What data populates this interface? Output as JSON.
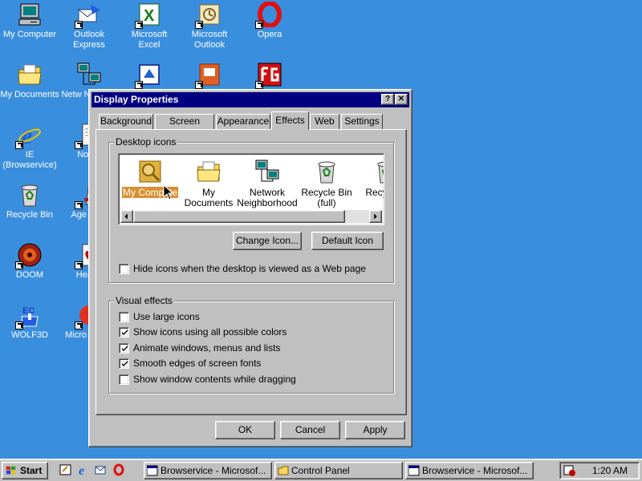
{
  "desktop": {
    "icons": [
      {
        "label": "My Computer"
      },
      {
        "label": "Outlook Express"
      },
      {
        "label": "Microsoft Excel"
      },
      {
        "label": "Microsoft Outlook"
      },
      {
        "label": "Opera"
      },
      {
        "label": "My Documents"
      },
      {
        "label": "Netw Neighbo"
      },
      {
        "label": "IE (Browservice)"
      },
      {
        "label": "Notep"
      },
      {
        "label": "Recycle Bin"
      },
      {
        "label": "Age Emp"
      },
      {
        "label": "DOOM"
      },
      {
        "label": "Hearts"
      },
      {
        "label": "WOLF3D"
      },
      {
        "label": "Micro Visual"
      }
    ]
  },
  "dialog": {
    "title": "Display Properties",
    "help_button": "?",
    "close_button": "✕",
    "tabs": [
      {
        "label": "Background"
      },
      {
        "label": "Screen Saver"
      },
      {
        "label": "Appearance"
      },
      {
        "label": "Effects"
      },
      {
        "label": "Web"
      },
      {
        "label": "Settings"
      }
    ],
    "active_tab": "Effects",
    "desktop_icons": {
      "group_label": "Desktop icons",
      "items": [
        {
          "label": "My Compute",
          "selected": true
        },
        {
          "label": "My Documents"
        },
        {
          "label": "Network Neighborhood"
        },
        {
          "label": "Recycle Bin (full)"
        },
        {
          "label": "Recy (em"
        }
      ],
      "change_icon_button": "Change Icon...",
      "default_icon_button": "Default Icon",
      "hide_icons_checkbox": {
        "label": "Hide icons when the desktop is viewed as a Web page",
        "checked": false
      }
    },
    "visual_effects": {
      "group_label": "Visual effects",
      "options": [
        {
          "label": "Use large icons",
          "checked": false
        },
        {
          "label": "Show icons using all possible colors",
          "checked": true
        },
        {
          "label": "Animate windows, menus and lists",
          "checked": true
        },
        {
          "label": "Smooth edges of screen fonts",
          "checked": true
        },
        {
          "label": "Show window contents while dragging",
          "checked": false
        }
      ]
    },
    "buttons": {
      "ok": "OK",
      "cancel": "Cancel",
      "apply": "Apply"
    }
  },
  "taskbar": {
    "start_label": "Start",
    "tasks": [
      {
        "label": "Browservice - Microsof..."
      },
      {
        "label": "Control Panel"
      },
      {
        "label": "Browservice - Microsof..."
      }
    ],
    "clock": "1:20 AM"
  },
  "colors": {
    "desktop": "#3a8ede",
    "titlebar": "#000080",
    "face": "#c0c0c0"
  }
}
